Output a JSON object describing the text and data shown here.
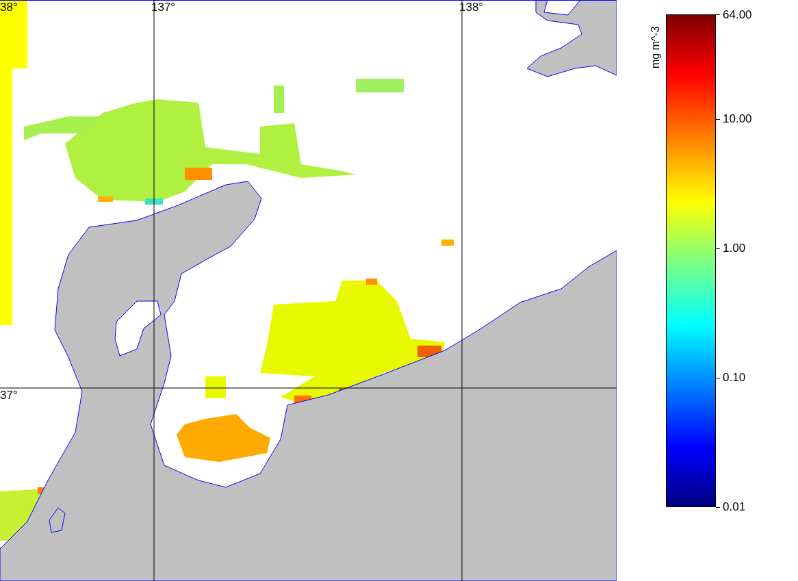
{
  "map": {
    "lon_labels": [
      "137°",
      "138°"
    ],
    "lat_labels": [
      "38°",
      "37°"
    ]
  },
  "colorbar": {
    "label": "mg m^-3",
    "ticks": [
      "64.00",
      "10.00",
      "1.00",
      "0.10",
      "0.01"
    ]
  }
}
